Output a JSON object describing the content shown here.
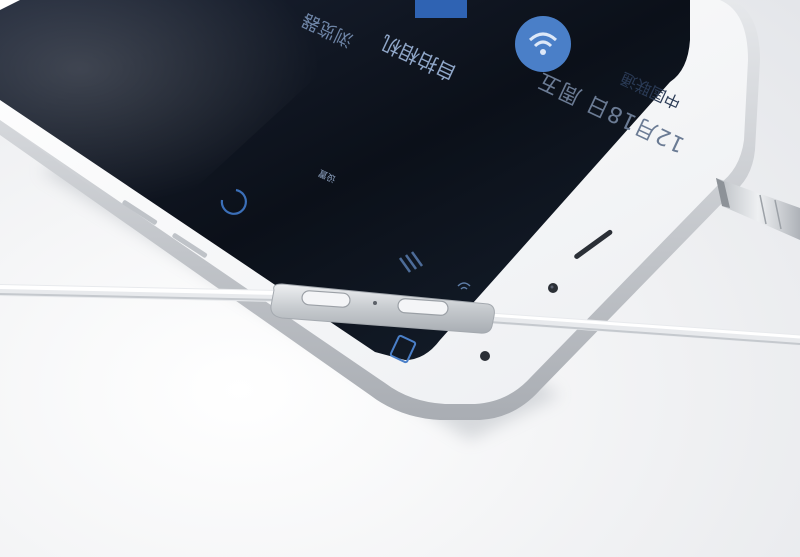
{
  "scene": {
    "description_visible_text": true
  },
  "screen": {
    "carrier_label": "中国联通",
    "date_label": "12月18日 周五",
    "app_label_1": "自拍相机",
    "app_label_2": "浏览器",
    "small_label": "设置"
  },
  "colors": {
    "background": "#f0f1f3",
    "phone_body": "#ffffff",
    "phone_frame": "#c9ccd1",
    "screen": "#0d1420",
    "accent_blue": "#4a7fc8",
    "remote_metal": "#cfd3d8"
  },
  "icons": [
    "wifi-signal-icon",
    "battery-icon",
    "loading-circle-icon",
    "earpiece-slot-icon",
    "camera-icon",
    "headphone-jack-icon",
    "volume-up-button-icon",
    "volume-down-button-icon",
    "microphone-hole-icon"
  ]
}
